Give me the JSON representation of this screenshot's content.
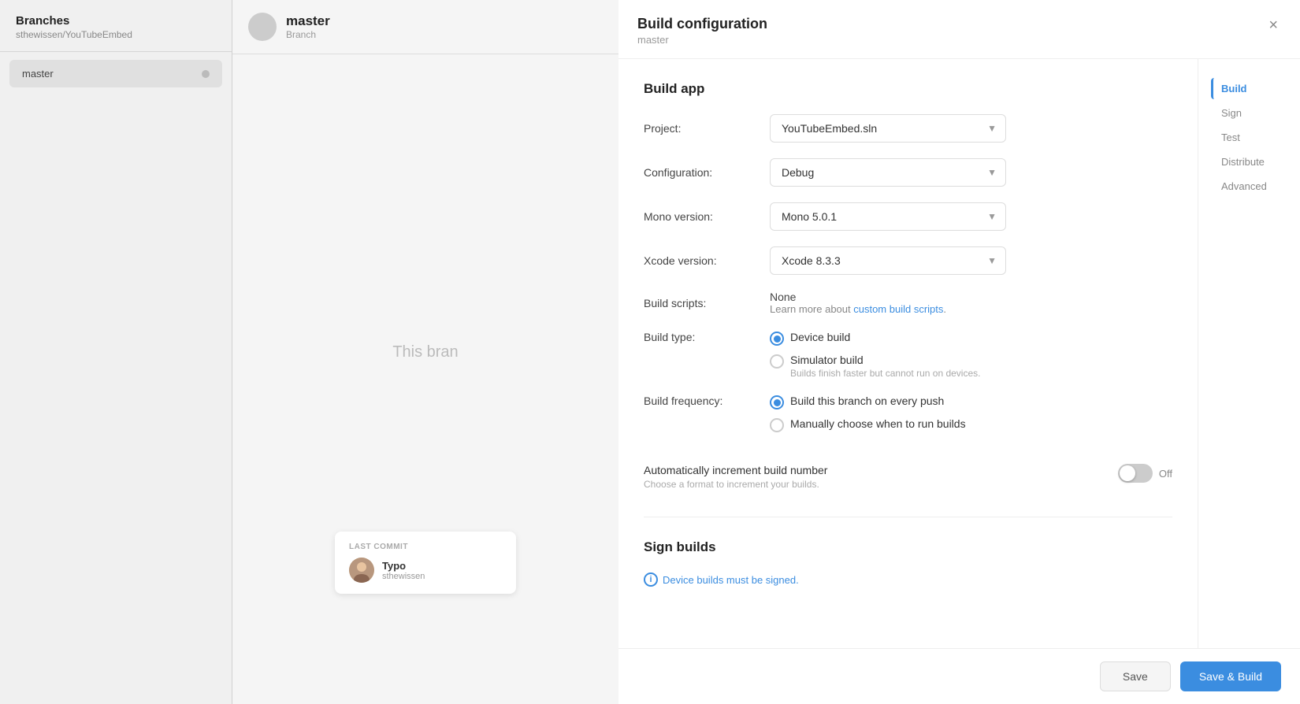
{
  "sidebar": {
    "title": "Branches",
    "subtitle": "sthewissen/YouTubeEmbed",
    "branch_item": {
      "name": "master",
      "has_dot": true
    }
  },
  "middle": {
    "branch_name": "master",
    "branch_label": "Branch",
    "empty_text": "This bran",
    "last_commit": {
      "label": "LAST COMMIT",
      "message": "Typo",
      "author": "sthewissen"
    }
  },
  "modal": {
    "title": "Build configuration",
    "subtitle": "master",
    "close_label": "×",
    "nav_items": [
      {
        "id": "build",
        "label": "Build",
        "active": true
      },
      {
        "id": "sign",
        "label": "Sign",
        "active": false
      },
      {
        "id": "test",
        "label": "Test",
        "active": false
      },
      {
        "id": "distribute",
        "label": "Distribute",
        "active": false
      },
      {
        "id": "advanced",
        "label": "Advanced",
        "active": false
      }
    ],
    "build_section": {
      "title": "Build app",
      "project_label": "Project:",
      "project_value": "YouTubeEmbed.sln",
      "configuration_label": "Configuration:",
      "configuration_value": "Debug",
      "mono_label": "Mono version:",
      "mono_value": "Mono 5.0.1",
      "xcode_label": "Xcode version:",
      "xcode_value": "Xcode 8.3.3",
      "scripts_label": "Build scripts:",
      "scripts_none": "None",
      "scripts_learn": "Learn more about ",
      "scripts_link_text": "custom build scripts",
      "scripts_link_suffix": ".",
      "build_type_label": "Build type:",
      "build_types": [
        {
          "id": "device",
          "label": "Device build",
          "checked": true,
          "sublabel": ""
        },
        {
          "id": "simulator",
          "label": "Simulator build",
          "checked": false,
          "sublabel": "Builds finish faster but cannot run on devices."
        }
      ],
      "build_freq_label": "Build frequency:",
      "build_freqs": [
        {
          "id": "every_push",
          "label": "Build this branch on every push",
          "checked": true,
          "sublabel": ""
        },
        {
          "id": "manual",
          "label": "Manually choose when to run builds",
          "checked": false,
          "sublabel": ""
        }
      ],
      "auto_increment_title": "Automatically increment build number",
      "auto_increment_desc": "Choose a format to increment your builds.",
      "toggle_state": "Off"
    },
    "sign_section": {
      "title": "Sign builds",
      "info_text": "Device builds must be signed."
    },
    "footer": {
      "save_label": "Save",
      "save_build_label": "Save & Build"
    }
  }
}
